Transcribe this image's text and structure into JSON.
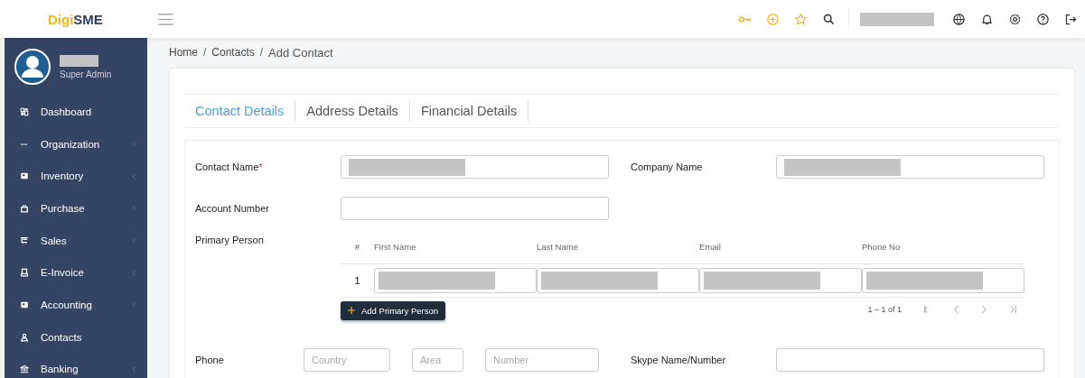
{
  "header": {
    "logo": {
      "part_1": "Digi",
      "part_2": "SME"
    },
    "user_name_hidden": true,
    "icons": [
      {
        "kind": "key"
      },
      {
        "kind": "plus"
      },
      {
        "kind": "star"
      },
      {
        "kind": "search"
      }
    ],
    "right_icons": [
      {
        "kind": "globe"
      },
      {
        "kind": "bell"
      },
      {
        "kind": "gear"
      },
      {
        "kind": "help"
      },
      {
        "kind": "logout"
      }
    ]
  },
  "sidebar": {
    "user": {
      "name_hidden": true,
      "role": "Super Admin"
    },
    "items": [
      {
        "label": "Dashboard",
        "kind": "grid",
        "has_submenu": false
      },
      {
        "label": "Organization",
        "kind": "dots",
        "has_submenu": true
      },
      {
        "label": "Inventory",
        "kind": "box",
        "has_submenu": true
      },
      {
        "label": "Purchase",
        "kind": "bag",
        "has_submenu": true
      },
      {
        "label": "Sales",
        "kind": "cart",
        "has_submenu": true
      },
      {
        "label": "E-Invoice",
        "kind": "doc",
        "has_submenu": true
      },
      {
        "label": "Accounting",
        "kind": "box",
        "has_submenu": true
      },
      {
        "label": "Contacts",
        "kind": "person",
        "has_submenu": false
      },
      {
        "label": "Banking",
        "kind": "bank",
        "has_submenu": true
      }
    ]
  },
  "breadcrumb": [
    {
      "kind": "link",
      "text": "Home"
    },
    {
      "kind": "separator",
      "text": "/"
    },
    {
      "kind": "link",
      "text": "Contacts"
    },
    {
      "kind": "separator",
      "text": "/"
    },
    {
      "kind": "current",
      "text": "Add Contact"
    }
  ],
  "tabs": [
    {
      "label": "Contact Details",
      "selected": true
    },
    {
      "label": "Address Details",
      "selected": false
    },
    {
      "label": "Financial Details",
      "selected": false
    }
  ],
  "form": {
    "contact_name": {
      "label": "Contact Name",
      "required_mark": "*",
      "value_hidden": true
    },
    "company_name": {
      "label": "Company Name",
      "value_hidden": true
    },
    "account_number": {
      "label": "Account Number"
    },
    "primary_person": {
      "label": "Primary Person",
      "columns": [
        "#",
        "First Name",
        "Last Name",
        "Email",
        "Phone No"
      ],
      "rows": [
        {
          "index": "1",
          "first_name_hidden": true,
          "last_name_hidden": true,
          "email_hidden": true,
          "phone_hidden": true
        }
      ],
      "add_button": "Add Primary Person",
      "range": "1 – 1 of 1"
    },
    "phone": {
      "label": "Phone",
      "country_placeholder": "Country",
      "area_placeholder": "Area",
      "number_placeholder": "Number"
    },
    "skype": {
      "label": "Skype Name/Number"
    }
  }
}
